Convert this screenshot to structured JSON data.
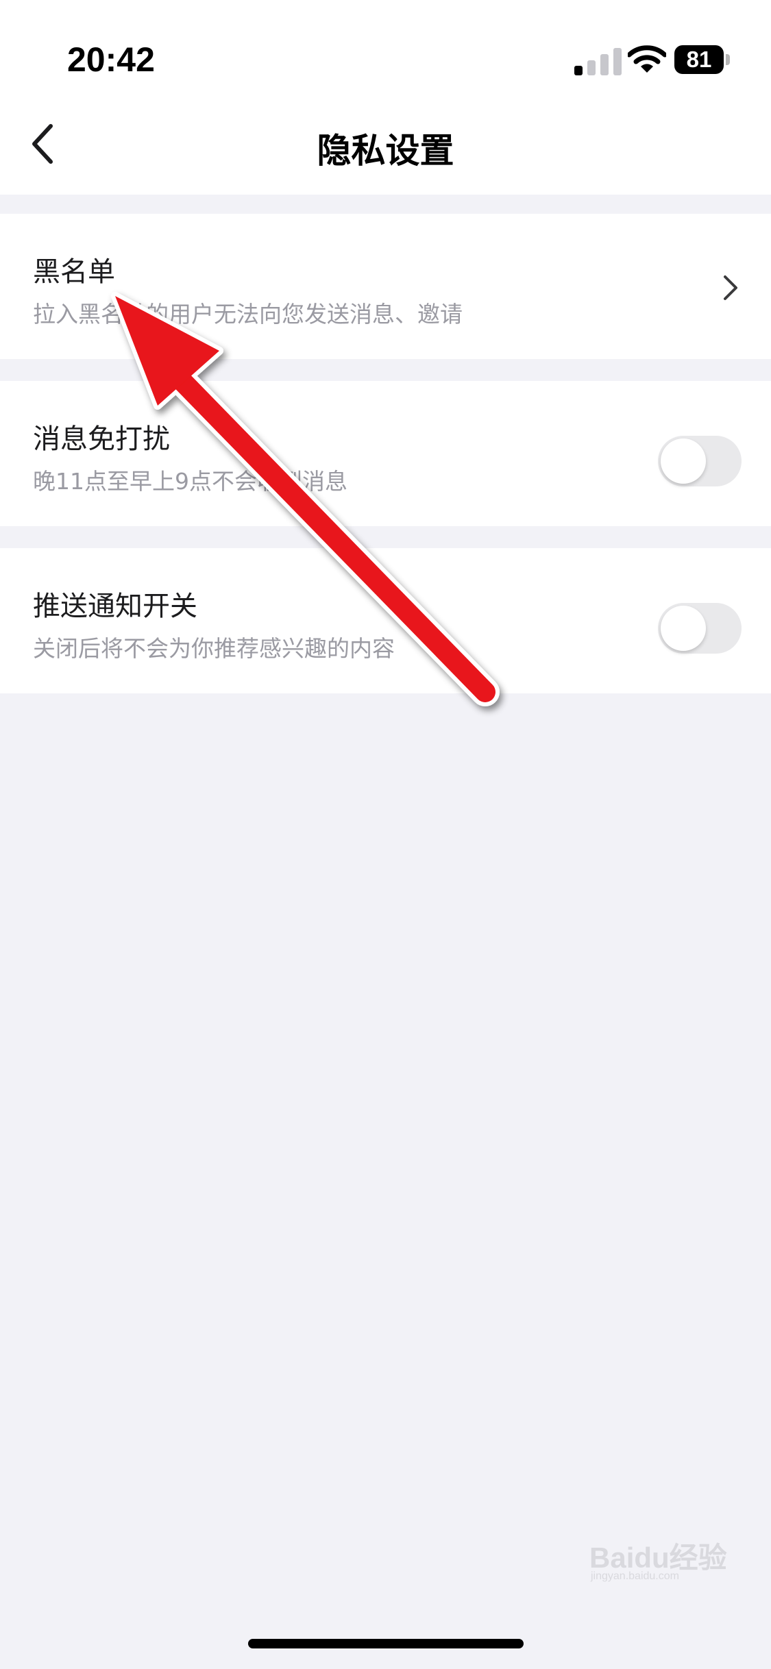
{
  "status_bar": {
    "time": "20:42",
    "battery_level": "81",
    "icons": [
      "signal-icon",
      "wifi-icon",
      "battery-icon"
    ]
  },
  "nav": {
    "title": "隐私设置",
    "back_icon": "chevron-left-icon"
  },
  "settings": [
    {
      "title": "黑名单",
      "subtitle": "拉入黑名单的用户无法向您发送消息、邀请",
      "control": "chevron-right-icon"
    },
    {
      "title": "消息免打扰",
      "subtitle": "晚11点至早上9点不会收到消息",
      "control": "toggle",
      "toggle_on": false
    },
    {
      "title": "推送通知开关",
      "subtitle": "关闭后将不会为你推荐感兴趣的内容",
      "control": "toggle",
      "toggle_on": false
    }
  ],
  "overlay": {
    "annotation_icon": "red-arrow-icon",
    "color": "#e8141a"
  },
  "watermark": {
    "main": "Baidu经验",
    "sub": "jingyan.baidu.com"
  },
  "colors": {
    "background": "#f2f2f7",
    "card": "#ffffff",
    "toggle_off": "#e9e9eb",
    "subtitle": "#9a9aa2"
  }
}
